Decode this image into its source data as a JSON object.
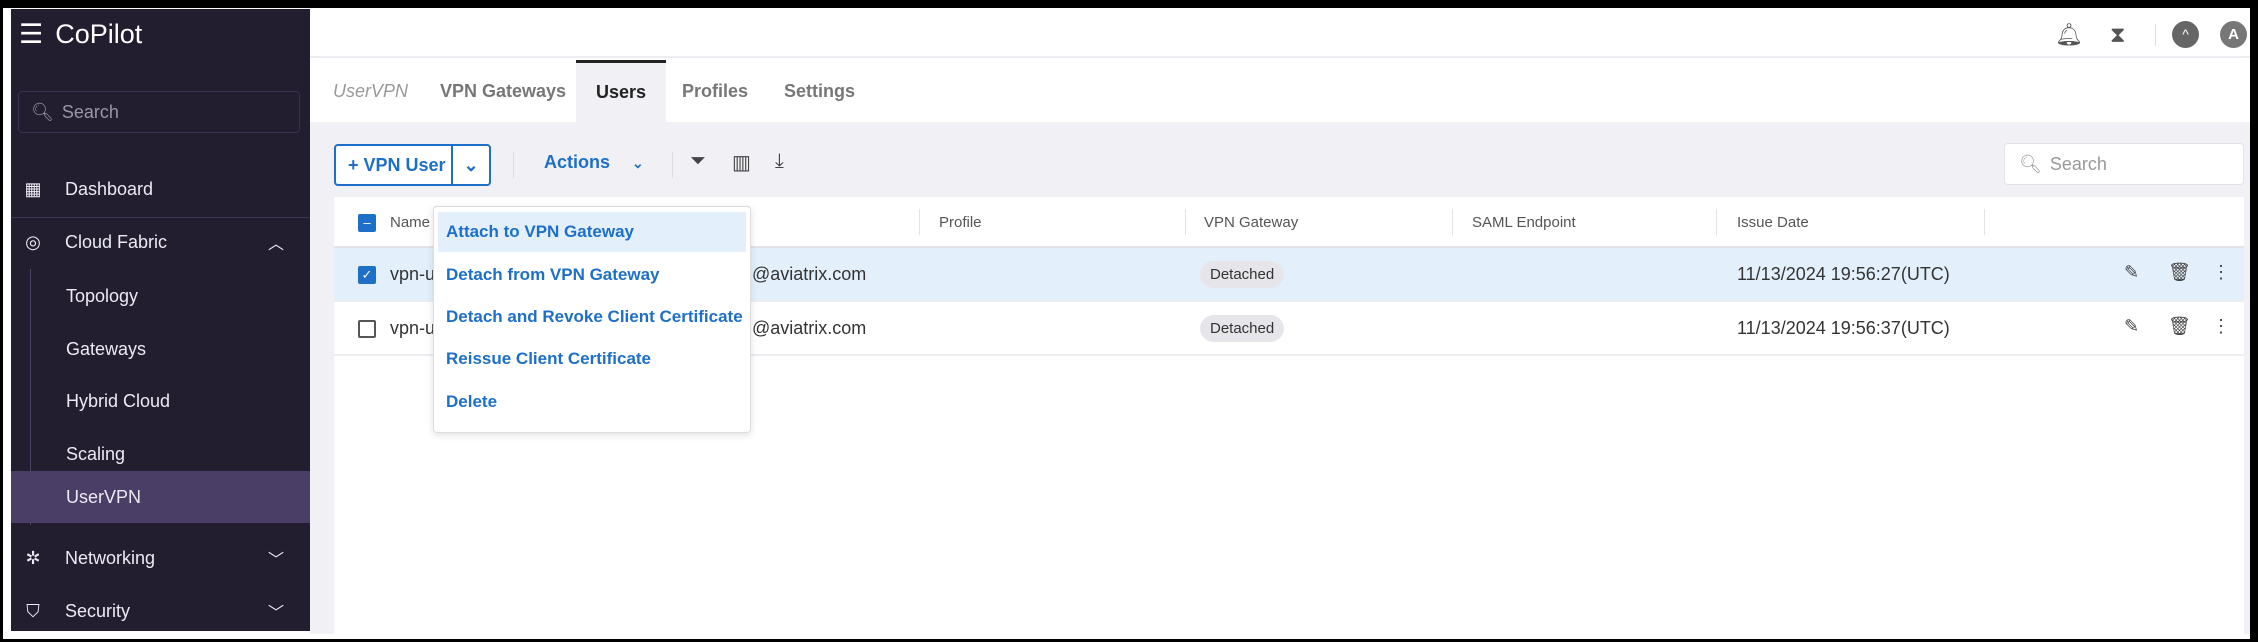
{
  "app": {
    "title": "CoPilot"
  },
  "sidebar": {
    "search_placeholder": "Search",
    "items": [
      {
        "label": "Dashboard",
        "icon": "dashboard-icon"
      },
      {
        "label": "Cloud Fabric",
        "icon": "cloud-fabric-icon",
        "expanded": true
      },
      {
        "label": "Topology"
      },
      {
        "label": "Gateways"
      },
      {
        "label": "Hybrid Cloud"
      },
      {
        "label": "Scaling"
      },
      {
        "label": "UserVPN",
        "active": true
      },
      {
        "label": "Networking",
        "icon": "networking-icon"
      },
      {
        "label": "Security",
        "icon": "shield-icon"
      }
    ]
  },
  "topbar": {
    "avatar": "A"
  },
  "tabs": {
    "section": "UserVPN",
    "items": [
      "VPN Gateways",
      "Users",
      "Profiles",
      "Settings"
    ],
    "selected": "Users"
  },
  "toolbar": {
    "add_label": "+ VPN User",
    "actions_label": "Actions",
    "search_placeholder": "Search"
  },
  "actions_menu": [
    "Attach to VPN Gateway",
    "Detach from VPN Gateway",
    "Detach and Revoke Client Certificate",
    "Reissue Client Certificate",
    "Delete"
  ],
  "table": {
    "columns": [
      "Name",
      "Profile",
      "VPN Gateway",
      "SAML Endpoint",
      "Issue Date"
    ],
    "rows": [
      {
        "name": "vpn-u",
        "email": "@aviatrix.com",
        "gateway": "Detached",
        "issue_date": "11/13/2024 19:56:27(UTC)",
        "checked": true
      },
      {
        "name": "vpn-u",
        "email": "@aviatrix.com",
        "gateway": "Detached",
        "issue_date": "11/13/2024 19:56:37(UTC)",
        "checked": false
      }
    ]
  },
  "colors": {
    "sidebar": "#221e30",
    "accent": "#1e6fc8",
    "active_nav": "#4a3d66",
    "selected_row": "#e3f0fc"
  }
}
